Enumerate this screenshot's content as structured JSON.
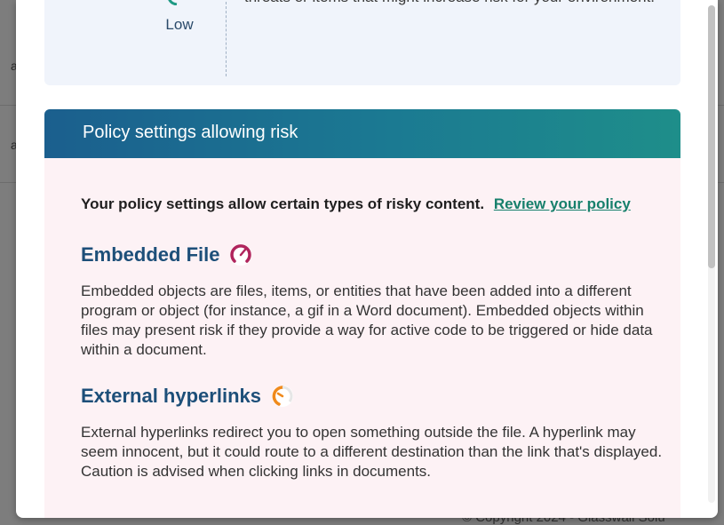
{
  "background": {
    "row_letters": [
      "a",
      "a"
    ],
    "footer_text": "© Copyright 2024 - Glasswall Solu"
  },
  "risk_summary": {
    "level": "Low",
    "description": "threats or items that might increase risk for your environment."
  },
  "policy_section": {
    "title": "Policy settings allowing risk",
    "intro_text": "Your policy settings allow certain types of risky content.",
    "review_link": "Review your policy",
    "items": [
      {
        "title": "Embedded File",
        "icon": "gauge-high-risk-icon",
        "icon_color": "#b0245c",
        "body": "Embedded objects are files, items, or entities that have been added into a different program or object (for instance, a gif in a Word document). Embedded objects within files may present risk if they provide a way for active code to be triggered or hide data within a document."
      },
      {
        "title": "External hyperlinks",
        "icon": "gauge-medium-risk-icon",
        "icon_color": "#f08a1c",
        "body": "External hyperlinks redirect you to open something outside the file. A hyperlink may seem innocent, but it could route to a different destination than the link that's displayed. Caution is advised when clicking links in documents."
      }
    ]
  },
  "colors": {
    "header_gradient_start": "#1b5f8e",
    "header_gradient_end": "#1e8e8a",
    "link": "#17806c",
    "item_title": "#1d4f79",
    "policy_bg": "#fdf2f5",
    "risk_card_bg": "#f0f4fb"
  }
}
